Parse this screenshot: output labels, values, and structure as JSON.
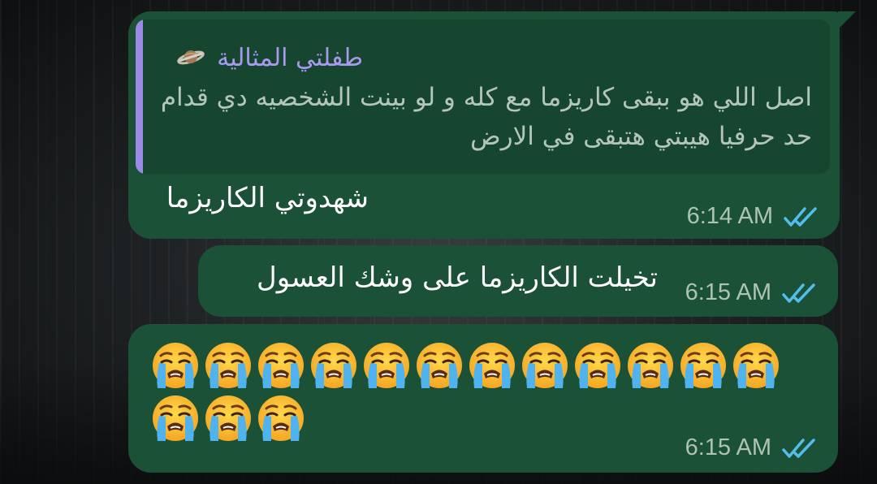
{
  "messages": [
    {
      "reply": {
        "author": "طفلتي المثالية",
        "author_icon": "ringed-planet-icon",
        "text": "اصل اللي هو ببقى كاريزما مع كله و لو بينت الشخصيه دي قدام حد حرفيا هيبتي هتبقى في الارض"
      },
      "text": "شهدوتي الكاريزما",
      "time": "6:14 AM",
      "status": "read-double-check"
    },
    {
      "text": "تخيلت الكاريزما على وشك العسول",
      "time": "6:15 AM",
      "status": "read-double-check"
    },
    {
      "emoji": "loudly-crying-face",
      "emoji_count": 15,
      "time": "6:15 AM",
      "status": "read-double-check"
    }
  ],
  "colors": {
    "bubble": "#1b5137",
    "quote_background": "#174630",
    "quote_bar": "#9b8ae6",
    "quote_author": "#a899ee",
    "quote_text": "#b4c6bb",
    "timestamp": "#aec2b6",
    "read_ticks": "#53bdeb"
  }
}
